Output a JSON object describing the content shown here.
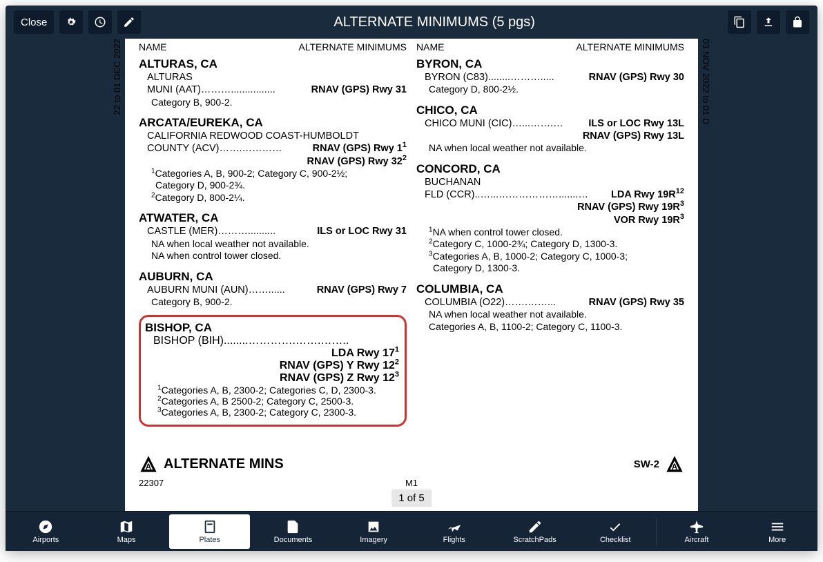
{
  "topbar": {
    "close": "Close",
    "title": "ALTERNATE MINIMUMS (5 pgs)"
  },
  "sideDates": {
    "left": "22  to  01 DEC 2022",
    "right": "03 NOV 2022  to  01 D"
  },
  "headers": {
    "name": "NAME",
    "altmin": "ALTERNATE MINIMUMS"
  },
  "leftCol": [
    {
      "city": "ALTURAS, CA",
      "airportLine": "ALTURAS",
      "airportLine2": "MUNI (AAT)………................",
      "rwy": "RNAV (GPS) Rwy 31",
      "notes": [
        "Category B, 900-2."
      ]
    },
    {
      "city": "ARCATA/EUREKA, CA",
      "airportLine": "CALIFORNIA REDWOOD COAST-HUMBOLDT",
      "airportLine2": "COUNTY (ACV)…….…………",
      "rwy": "RNAV (GPS) Rwy 1",
      "rwySup": "1",
      "extraRwys": [
        {
          "t": "RNAV (GPS) Rwy 32",
          "s": "2"
        }
      ],
      "notes": [
        "Categories A, B, 900-2; Category C, 900-2½;",
        "Category D, 900-2¾.",
        "Category D, 800-2¼."
      ],
      "noteSups": [
        "1",
        "",
        "2"
      ]
    },
    {
      "city": "ATWATER, CA",
      "airportLine2": "CASTLE (MER)………..........",
      "rwy": "ILS or LOC Rwy 31",
      "notes": [
        "NA when local weather not available.",
        "NA when control tower closed."
      ]
    },
    {
      "city": "AUBURN, CA",
      "airportLine2": "AUBURN MUNI (AUN)……......",
      "rwy": "RNAV (GPS) Rwy 7",
      "notes": [
        "Category B, 900-2."
      ]
    }
  ],
  "bishop": {
    "city": "BISHOP, CA",
    "airportLine2": "BISHOP (BIH)........………….…….……..",
    "rwy": "LDA Rwy 17",
    "rwySup": "1",
    "extraRwys": [
      {
        "t": "RNAV (GPS) Y Rwy 12",
        "s": "2"
      },
      {
        "t": "RNAV (GPS) Z Rwy 12",
        "s": "3"
      }
    ],
    "notes": [
      "Categories A, B, 2300-2; Categories C, D, 2300-3.",
      "Categories A, B 2500-2; Category C, 2500-3.",
      "Categories A, B, 2300-2; Category C, 2300-3."
    ],
    "noteSups": [
      "1",
      "2",
      "3"
    ]
  },
  "rightCol": [
    {
      "city": "BYRON, CA",
      "airportLine2": "BYRON (C83)........……….....",
      "rwy": "RNAV (GPS) Rwy 30",
      "notes": [
        "Category D, 800-2½."
      ]
    },
    {
      "city": "CHICO, CA",
      "airportLine2": "CHICO MUNI (CIC)…...…….…",
      "rwy": "ILS or LOC Rwy 13L",
      "extraRwys": [
        {
          "t": "RNAV (GPS) Rwy 13L"
        }
      ],
      "notes": [
        "NA when local weather not available."
      ]
    },
    {
      "city": "CONCORD, CA",
      "airportLine": "BUCHANAN",
      "airportLine2": "FLD (CCR)..…...……………….......…",
      "rwy": "LDA Rwy 19R",
      "rwySup": "12",
      "extraRwys": [
        {
          "t": "RNAV (GPS) Rwy 19R",
          "s": "3"
        },
        {
          "t": "VOR Rwy 19R",
          "s": "3"
        }
      ],
      "notes": [
        "NA when control tower closed.",
        "Category C, 1000-2¾; Category D, 1300-3.",
        "Categories A, B, 1000-2; Category C, 1000-3;",
        "Category D, 1300-3."
      ],
      "noteSups": [
        "1",
        "2",
        "3",
        ""
      ]
    },
    {
      "city": "COLUMBIA, CA",
      "airportLine2": "COLUMBIA (O22)…….……...",
      "rwy": "RNAV (GPS) Rwy 35",
      "notes": [
        "NA when local weather not available.",
        "Categories A, B, 1100-2; Category C, 1100-3."
      ]
    }
  ],
  "footer": {
    "altMins": "ALTERNATE MINS",
    "sw": "SW-2",
    "leftNum": "22307",
    "midM": "M1",
    "pageInd": "1 of 5"
  },
  "nav": {
    "airports": "Airports",
    "maps": "Maps",
    "plates": "Plates",
    "documents": "Documents",
    "imagery": "Imagery",
    "flights": "Flights",
    "scratchpads": "ScratchPads",
    "checklist": "Checklist",
    "aircraft": "Aircraft",
    "more": "More"
  }
}
